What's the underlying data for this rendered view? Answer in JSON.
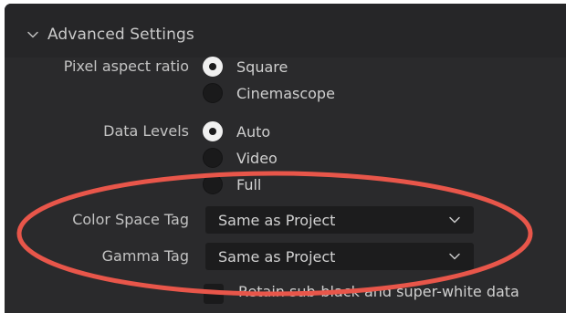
{
  "advanced_settings": {
    "title": "Advanced Settings",
    "expanded_icon": "chevron-down-icon"
  },
  "pixel_aspect_ratio": {
    "label": "Pixel aspect ratio",
    "options": [
      {
        "label": "Square",
        "selected": true
      },
      {
        "label": "Cinemascope",
        "selected": false
      }
    ]
  },
  "data_levels": {
    "label": "Data Levels",
    "options": [
      {
        "label": "Auto",
        "selected": true
      },
      {
        "label": "Video",
        "selected": false
      },
      {
        "label": "Full",
        "selected": false
      }
    ]
  },
  "color_space_tag": {
    "label": "Color Space Tag",
    "value": "Same as Project"
  },
  "gamma_tag": {
    "label": "Gamma Tag",
    "value": "Same as Project"
  },
  "retain_data": {
    "label": "Retain sub-black and super-white data",
    "checked": false
  },
  "colors": {
    "panel_bg": "#2a2a2c",
    "text": "#c3c3c3",
    "annotation": "#e8564a"
  }
}
